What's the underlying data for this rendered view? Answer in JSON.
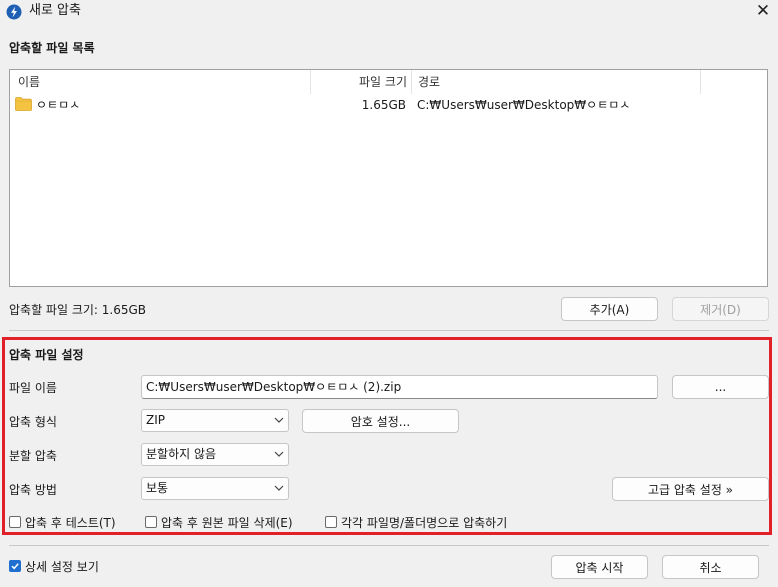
{
  "window": {
    "title": "새로 압축",
    "close_glyph": "✕"
  },
  "file_list": {
    "section_title": "압축할 파일 목록",
    "columns": {
      "name": "이름",
      "size": "파일 크기",
      "path": "경로"
    },
    "rows": [
      {
        "name": "ㅇㅌㅁㅅ",
        "size": "1.65GB",
        "path": "C:₩Users₩user₩Desktop₩ㅇㅌㅁㅅ",
        "icon": "folder-icon"
      }
    ],
    "total_size_label": "압축할 파일 크기: 1.65GB",
    "add_button": "추가(A)",
    "remove_button": "제거(D)"
  },
  "settings": {
    "section_title": "압축 파일 설정",
    "filename_label": "파일 이름",
    "filename_value": "C:₩Users₩user₩Desktop₩ㅇㅌㅁㅅ (2).zip",
    "browse_button": "...",
    "format_label": "압축 형식",
    "format_value": "ZIP",
    "password_button": "암호 설정...",
    "split_label": "분할 압축",
    "split_value": "분할하지 않음",
    "method_label": "압축 방법",
    "method_value": "보통",
    "advanced_button": "고급 압축 설정 »",
    "test_after": "압축 후 테스트(T)",
    "delete_after": "압축 후 원본 파일 삭제(E)",
    "each_separately": "각각 파일명/폴더명으로 압축하기"
  },
  "footer": {
    "show_details": "상세 설정 보기",
    "show_details_checked": true,
    "start_button": "압축 시작",
    "cancel_button": "취소"
  },
  "colors": {
    "highlight_border": "#e2202a",
    "checkbox_accent": "#1e6fd0",
    "folder": "#f5c342"
  }
}
